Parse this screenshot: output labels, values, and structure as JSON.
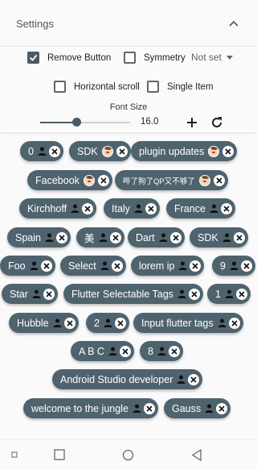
{
  "settings": {
    "title": "Settings",
    "options": {
      "remove_button": {
        "label": "Remove Button",
        "checked": true
      },
      "symmetry": {
        "label": "Symmetry",
        "checked": false
      },
      "not_set": {
        "label": "Not set"
      },
      "horizontal_scroll": {
        "label": "Horizontal scroll",
        "checked": false
      },
      "single_item": {
        "label": "Single Item",
        "checked": false
      }
    },
    "font_size": {
      "label": "Font Size",
      "value": "16.0",
      "slider_fraction": 0.4
    }
  },
  "tags": [
    {
      "text": "0",
      "icon": "person-icon"
    },
    {
      "text": "SDK",
      "icon": "avatar-icon"
    },
    {
      "text": "plugin updates",
      "icon": "avatar-icon"
    },
    {
      "text": "Facebook",
      "icon": "avatar-icon"
    },
    {
      "text": "哔了狗了QP又不够了",
      "icon": "avatar-icon"
    },
    {
      "text": "Kirchhoff",
      "icon": "person-icon"
    },
    {
      "text": "Italy",
      "icon": "person-icon"
    },
    {
      "text": "France",
      "icon": "person-icon"
    },
    {
      "text": "Spain",
      "icon": "person-icon"
    },
    {
      "text": "美",
      "icon": "person-icon"
    },
    {
      "text": "Dart",
      "icon": "person-icon"
    },
    {
      "text": "SDK",
      "icon": "person-icon"
    },
    {
      "text": "Foo",
      "icon": "person-icon"
    },
    {
      "text": "Select",
      "icon": "person-icon"
    },
    {
      "text": "lorem ip",
      "icon": "person-icon"
    },
    {
      "text": "9",
      "icon": "person-icon"
    },
    {
      "text": "Star",
      "icon": "person-icon"
    },
    {
      "text": "Flutter Selectable Tags",
      "icon": "person-icon"
    },
    {
      "text": "1",
      "icon": "person-icon"
    },
    {
      "text": "Hubble",
      "icon": "person-icon"
    },
    {
      "text": "2",
      "icon": "person-icon"
    },
    {
      "text": "Input flutter tags",
      "icon": "person-icon"
    },
    {
      "text": "A B C",
      "icon": "person-icon"
    },
    {
      "text": "8",
      "icon": "person-icon"
    },
    {
      "text": "Android Studio developer",
      "icon": "person-icon"
    },
    {
      "text": "welcome to the jungle",
      "icon": "person-icon"
    },
    {
      "text": "Gauss",
      "icon": "person-icon"
    }
  ],
  "colors": {
    "tag_bg": "#4f636f",
    "accent": "#4a5b66"
  },
  "nav": {
    "buttons": [
      "menu-icon",
      "square-icon",
      "circle-icon",
      "back-triangle-icon"
    ]
  }
}
